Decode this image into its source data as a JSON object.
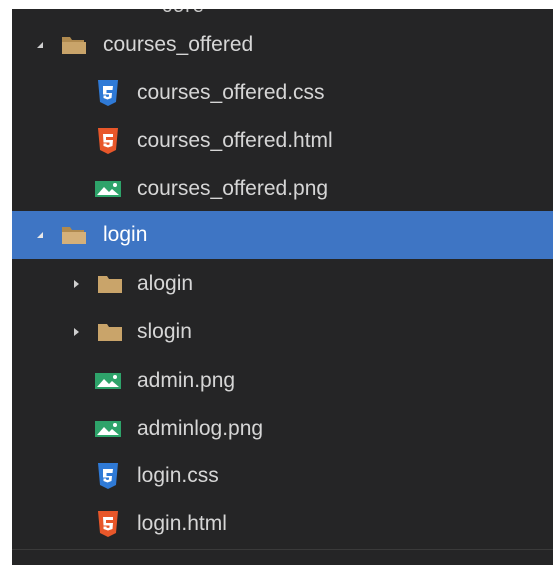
{
  "tree": {
    "top_cut_label": "core",
    "rows": [
      {
        "label": "courses_offered",
        "kind": "folder-open",
        "expanded": true,
        "selected": false,
        "depth": 0
      },
      {
        "label": "courses_offered.css",
        "kind": "css",
        "depth": 1
      },
      {
        "label": "courses_offered.html",
        "kind": "html",
        "depth": 1
      },
      {
        "label": "courses_offered.png",
        "kind": "image",
        "depth": 1
      },
      {
        "label": "login",
        "kind": "folder-open",
        "expanded": true,
        "selected": true,
        "depth": 0
      },
      {
        "label": "alogin",
        "kind": "folder-closed",
        "expanded": false,
        "depth": 1
      },
      {
        "label": "slogin",
        "kind": "folder-closed",
        "expanded": false,
        "depth": 1
      },
      {
        "label": "admin.png",
        "kind": "image",
        "depth": 1
      },
      {
        "label": "adminlog.png",
        "kind": "image",
        "depth": 1
      },
      {
        "label": "login.css",
        "kind": "css",
        "depth": 1
      },
      {
        "label": "login.html",
        "kind": "html",
        "depth": 1
      }
    ]
  },
  "colors": {
    "panel_bg": "#252526",
    "selection_bg": "#3e75c4",
    "folder": "#c9a46a",
    "css_icon": "#2f7ad6",
    "html_icon": "#e8572a",
    "image_icon": "#2ea36a"
  }
}
